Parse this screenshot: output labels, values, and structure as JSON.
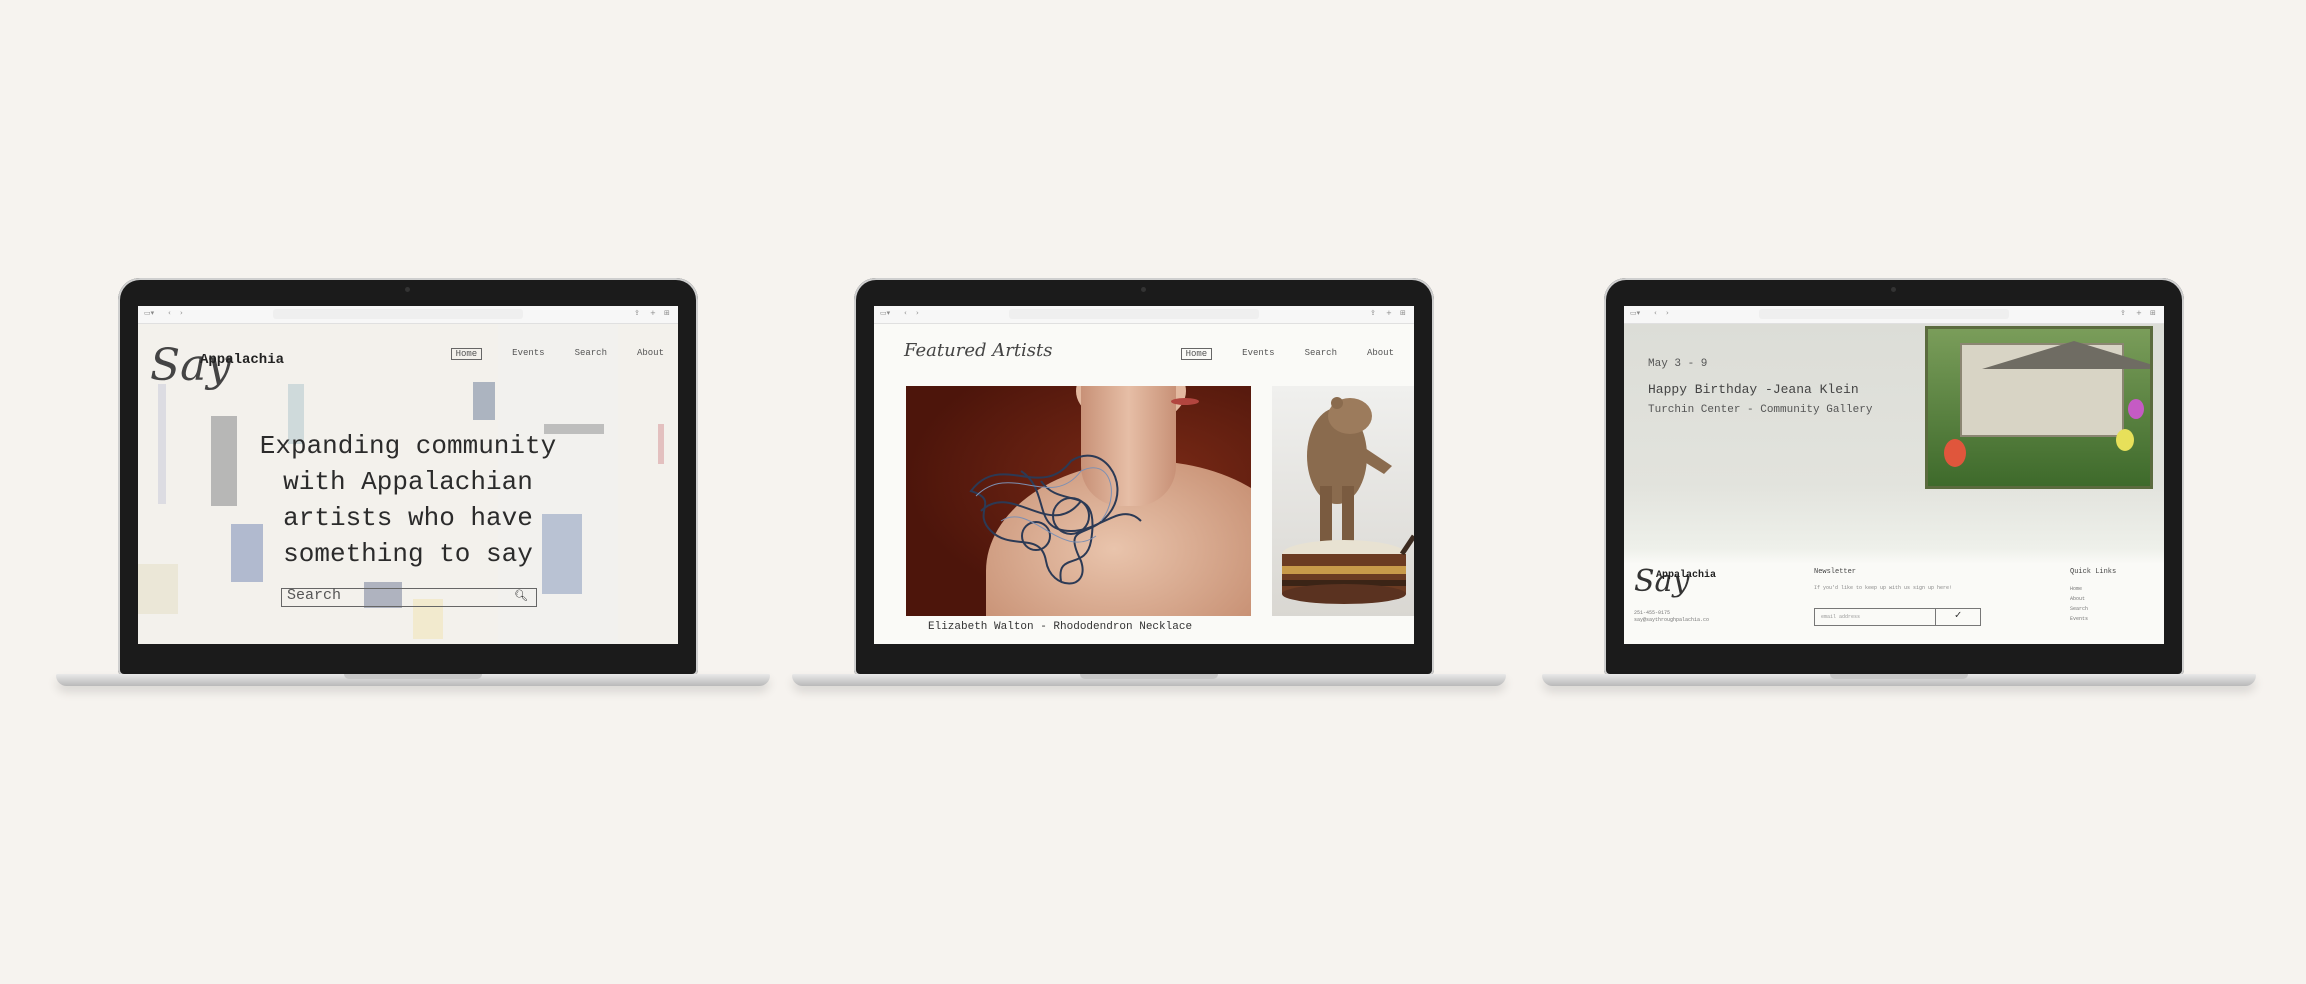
{
  "browser": {
    "back": "‹",
    "forward": "›",
    "share": "⇪",
    "new_tab": "+",
    "tabs": "⊞"
  },
  "nav": {
    "home": "Home",
    "events": "Events",
    "search": "Search",
    "about": "About"
  },
  "screen1": {
    "logo_script": "Say",
    "logo_text": "Appalachia",
    "headline": "Expanding community with Appalachian artists who have something to say",
    "search_placeholder": "Search"
  },
  "screen2": {
    "heading": "Featured Artists",
    "caption": "Elizabeth Walton - Rhododendron Necklace"
  },
  "screen3": {
    "date": "May 3 - 9",
    "event_title": "Happy Birthday -Jeana Klein",
    "venue": "Turchin Center - Community Gallery",
    "footer": {
      "logo_script": "Say",
      "logo_text": "Appalachia",
      "phone": "251-455-0175",
      "email": "say@saythroughpalachia.co",
      "newsletter_title": "Newsletter",
      "newsletter_sub": "If you'd like to keep up with us sign up here!",
      "email_placeholder": "email address",
      "submit_icon": "✓",
      "quick_links_title": "Quick Links",
      "quick_links": [
        "Home",
        "About",
        "Search",
        "Events"
      ]
    }
  }
}
